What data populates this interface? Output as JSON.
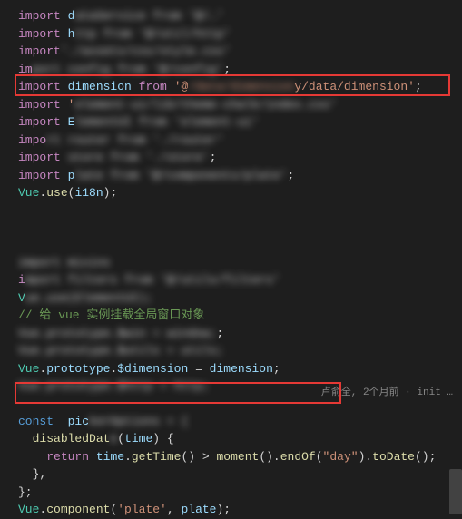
{
  "code": {
    "line1_kw": "import",
    "line1_var": "d",
    "line1_blur": "ataService from '@/…'",
    "line2_kw": "import",
    "line2_var": "h",
    "line2_blur": "ttp from '@/util/http'",
    "line3_kw": "import",
    "line3_blur": "'./assets/css/style.css'",
    "line4_kw": "im",
    "line4_blur": "port config from '@/config'",
    "line5_kw": "import",
    "line5_var": "dimension",
    "line5_from": "from",
    "line5_str_a": "'@",
    "line5_str_blur": "/data/dimension",
    "line5_str_b": "y/data/dimension'",
    "line6_kw": "import",
    "line6_str_a": "'",
    "line6_blur": "element-ui/lib/theme-chalk/index.css'",
    "line7_kw": "import",
    "line7_var": "E",
    "line7_blur": "lementUI from 'element-ui'",
    "line8_kw": "impo",
    "line8_blur": "rt router from './router'",
    "line9_kw": "import",
    "line9_blur": " store from './store'",
    "line10_kw": "import",
    "line10_var": "p",
    "line10_blur": "late from '@/components/plate'",
    "line11_class": "Vue",
    "line11_method": "use",
    "line11_arg": "i18n",
    "line15_blur": "import mixins",
    "line16_kw": "i",
    "line16_blur": "mport filters from '@/utils/filters'",
    "line17_kw": "V",
    "line17_blur": "ue.use(ElementUI);",
    "line18_comment": "// 给 vue 实例挂载全局窗口对象",
    "line19_blur": "Vue.prototype.$win = window;",
    "line20_blur": "Vue.prototype.$utils = utils;",
    "line21_class": "Vue",
    "line21_prop1": "prototype",
    "line21_prop2": "$dimension",
    "line21_eq": " = ",
    "line21_val": "dimension",
    "line22_blur": "Vue.prototype.$http = http;",
    "line24_kw": "const",
    "line24_var": "pic",
    "line24_blur": "kerOptions = {",
    "line25_method": "disabledDat",
    "line25_blur": "e",
    "line25_param": "time",
    "line26_kw": "return",
    "line26_var1": "time",
    "line26_m1": "getTime",
    "line26_gt": " > ",
    "line26_m2": "moment",
    "line26_m3": "endOf",
    "line26_str": "\"day\"",
    "line26_m4": "toDate",
    "line29_class": "Vue",
    "line29_method": "component",
    "line29_str": "'plate'",
    "line29_arg": "plate"
  },
  "annotation": "卢俞全, 2个月前 · init …"
}
